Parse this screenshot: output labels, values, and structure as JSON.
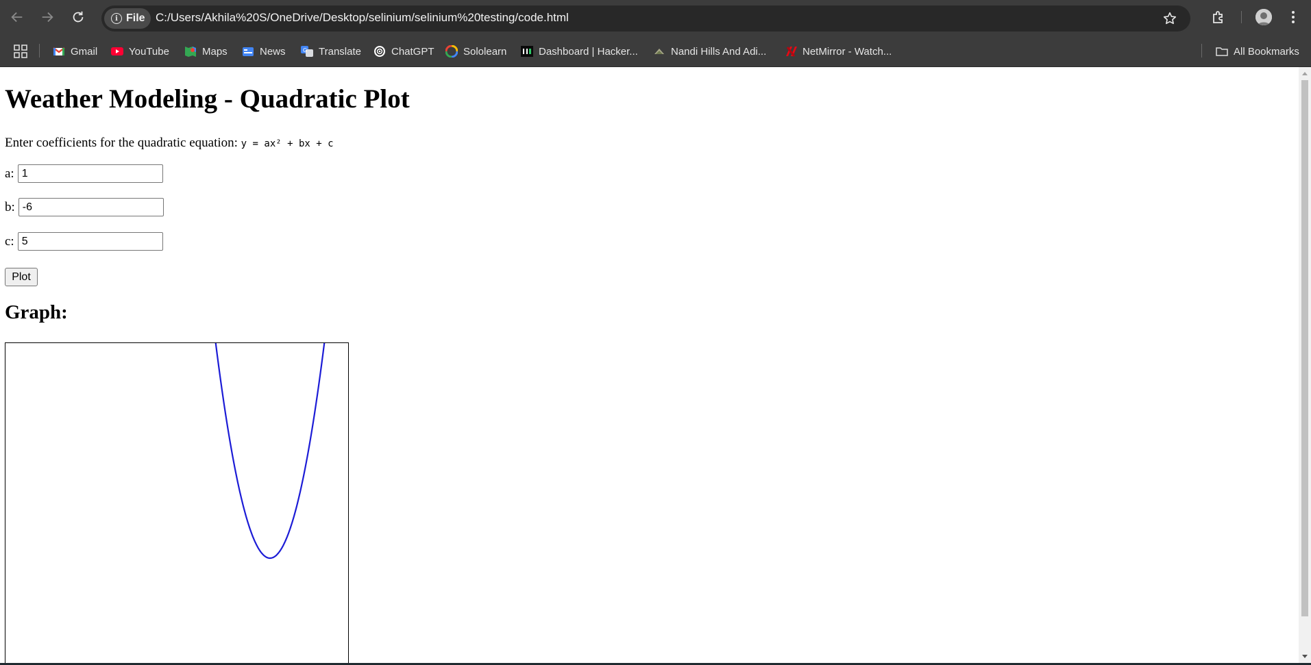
{
  "browser": {
    "file_chip_label": "File",
    "url": "C:/Users/Akhila%20S/OneDrive/Desktop/selinium/selinium%20testing/code.html",
    "bookmarks": [
      {
        "label": "Gmail",
        "icon": "gmail-icon"
      },
      {
        "label": "YouTube",
        "icon": "youtube-icon"
      },
      {
        "label": "Maps",
        "icon": "maps-icon"
      },
      {
        "label": "News",
        "icon": "news-icon"
      },
      {
        "label": "Translate",
        "icon": "translate-icon"
      },
      {
        "label": "ChatGPT",
        "icon": "chatgpt-icon"
      },
      {
        "label": "Sololearn",
        "icon": "sololearn-icon"
      },
      {
        "label": "Dashboard | Hacker...",
        "icon": "hackerrank-icon"
      },
      {
        "label": "Nandi Hills And Adi...",
        "icon": "nandi-hills-icon"
      },
      {
        "label": "NetMirror - Watch...",
        "icon": "netmirror-icon"
      }
    ],
    "all_bookmarks_label": "All Bookmarks"
  },
  "page": {
    "title": "Weather Modeling - Quadratic Plot",
    "instruction": "Enter coefficients for the quadratic equation:",
    "equation": "y = ax² + bx + c",
    "fields": [
      {
        "label": "a:",
        "value": "1"
      },
      {
        "label": "b:",
        "value": "-6"
      },
      {
        "label": "c:",
        "value": "5"
      }
    ],
    "plot_button": "Plot",
    "graph_heading": "Graph:"
  },
  "chart_data": {
    "type": "line",
    "title": "",
    "xlabel": "",
    "ylabel": "",
    "series": [
      {
        "equation": "y = x² - 6x + 5",
        "coefficients": {
          "a": 1,
          "b": -6,
          "c": 5
        },
        "color": "#1c1cd6"
      }
    ],
    "vertex": {
      "x": 3,
      "y": -4
    },
    "grid": false,
    "axes_visible": false
  },
  "colors": {
    "chrome_bg": "#3c3c3c",
    "omnibox_bg": "#282828",
    "curve": "#1c1cd6"
  }
}
